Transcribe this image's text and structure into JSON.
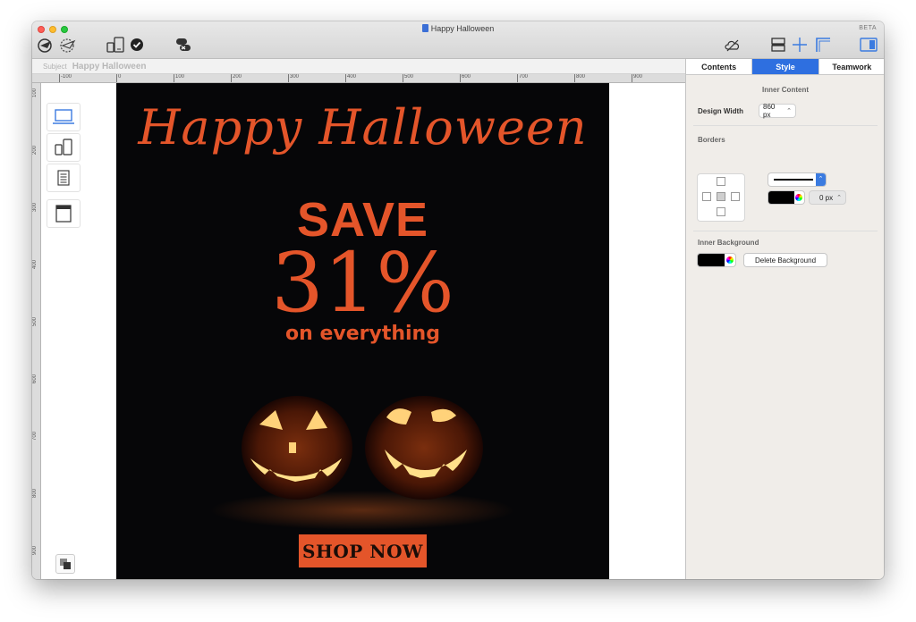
{
  "window": {
    "title": "Happy Halloween",
    "beta_badge": "BETA"
  },
  "toolbar": {
    "left_icons": [
      "send-icon",
      "preview-icon",
      "devices-icon",
      "check-icon",
      "link-icon"
    ],
    "right_icons": [
      "cloud-sync-icon",
      "layout-icon",
      "crosshair-icon",
      "guides-icon",
      "panel-toggle-icon"
    ]
  },
  "subject": {
    "label": "Subject",
    "value": "Happy Halloween"
  },
  "ruler": {
    "h_labels": [
      "-100",
      "0",
      "100",
      "200",
      "300",
      "400",
      "500",
      "600",
      "700",
      "800",
      "900"
    ],
    "v_labels": [
      "100",
      "200",
      "300",
      "400",
      "500",
      "600",
      "700",
      "800",
      "900"
    ]
  },
  "email": {
    "heading": "Happy Halloween",
    "save_line1": "SAVE",
    "save_line2": "31%",
    "save_line3": "on everything",
    "cta": "SHOP NOW",
    "accent": "#e4552a",
    "background": "#060608"
  },
  "panel": {
    "tabs": [
      "Contents",
      "Style",
      "Teamwork"
    ],
    "active_tab": "Style",
    "inner_content_title": "Inner Content",
    "design_width_label": "Design Width",
    "design_width_value": "860 px",
    "borders_title": "Borders",
    "border_width_value": "0 px",
    "inner_background_title": "Inner Background",
    "delete_background_label": "Delete Background",
    "border_color": "#000000",
    "background_color": "#000000"
  }
}
